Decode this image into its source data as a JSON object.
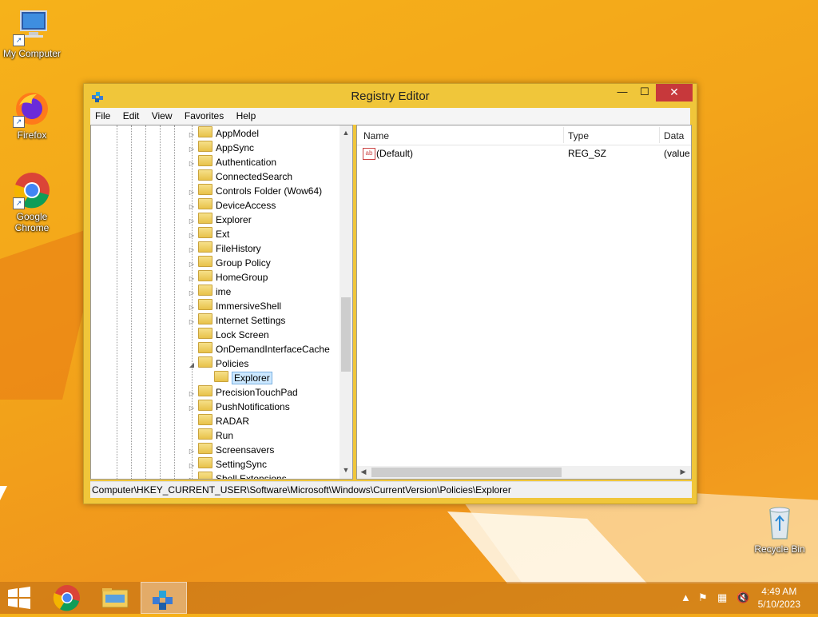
{
  "desktop": {
    "icons": [
      {
        "label": "My Computer",
        "icon": "computer-icon"
      },
      {
        "label": "Firefox",
        "icon": "firefox-icon"
      },
      {
        "label": "Google Chrome",
        "icon": "chrome-icon"
      },
      {
        "label": "Recycle Bin",
        "icon": "recycle-bin-icon"
      }
    ]
  },
  "window": {
    "title": "Registry Editor",
    "controls": {
      "minimize": "—",
      "maximize": "☐",
      "close": "✕"
    },
    "menu": [
      "File",
      "Edit",
      "View",
      "Favorites",
      "Help"
    ],
    "tree": [
      {
        "label": "AppModel",
        "expander": "▷"
      },
      {
        "label": "AppSync",
        "expander": "▷"
      },
      {
        "label": "Authentication",
        "expander": "▷"
      },
      {
        "label": "ConnectedSearch",
        "expander": ""
      },
      {
        "label": "Controls Folder (Wow64)",
        "expander": "▷"
      },
      {
        "label": "DeviceAccess",
        "expander": "▷"
      },
      {
        "label": "Explorer",
        "expander": "▷"
      },
      {
        "label": "Ext",
        "expander": "▷"
      },
      {
        "label": "FileHistory",
        "expander": "▷"
      },
      {
        "label": "Group Policy",
        "expander": "▷"
      },
      {
        "label": "HomeGroup",
        "expander": "▷"
      },
      {
        "label": "ime",
        "expander": "▷"
      },
      {
        "label": "ImmersiveShell",
        "expander": "▷"
      },
      {
        "label": "Internet Settings",
        "expander": "▷"
      },
      {
        "label": "Lock Screen",
        "expander": ""
      },
      {
        "label": "OnDemandInterfaceCache",
        "expander": ""
      },
      {
        "label": "Policies",
        "expander": "◢"
      },
      {
        "label": "Explorer",
        "expander": "",
        "child": true,
        "selected": true
      },
      {
        "label": "PrecisionTouchPad",
        "expander": "▷"
      },
      {
        "label": "PushNotifications",
        "expander": "▷"
      },
      {
        "label": "RADAR",
        "expander": ""
      },
      {
        "label": "Run",
        "expander": ""
      },
      {
        "label": "Screensavers",
        "expander": "▷"
      },
      {
        "label": "SettingSync",
        "expander": "▷"
      },
      {
        "label": "Shell Extensions",
        "expander": "▷"
      }
    ],
    "list": {
      "columns": [
        "Name",
        "Type",
        "Data"
      ],
      "rows": [
        {
          "name": "(Default)",
          "type": "REG_SZ",
          "data": "(value"
        }
      ]
    },
    "status_path": "Computer\\HKEY_CURRENT_USER\\Software\\Microsoft\\Windows\\CurrentVersion\\Policies\\Explorer"
  },
  "taskbar": {
    "pinned": [
      "start-button",
      "chrome",
      "file-explorer",
      "registry-editor"
    ],
    "clock": {
      "time": "4:49 AM",
      "date": "5/10/2023"
    }
  }
}
